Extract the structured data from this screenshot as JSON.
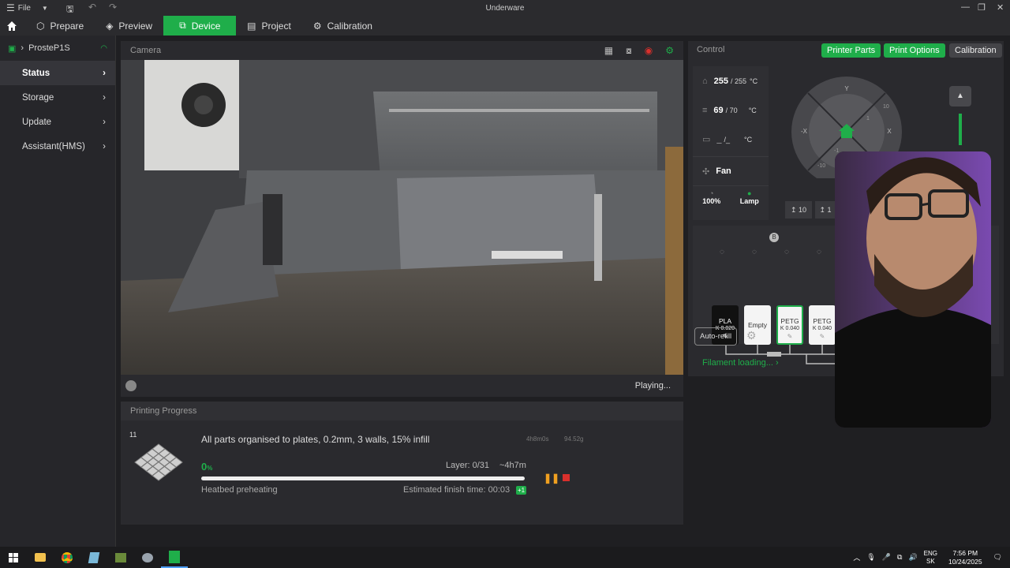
{
  "titlebar": {
    "file_label": "File",
    "app_title": "Underware"
  },
  "nav": {
    "tabs": [
      {
        "label": "Prepare"
      },
      {
        "label": "Preview"
      },
      {
        "label": "Device"
      },
      {
        "label": "Project"
      },
      {
        "label": "Calibration"
      }
    ]
  },
  "sidebar": {
    "device_name": "ProsteP1S",
    "items": [
      {
        "label": "Status"
      },
      {
        "label": "Storage"
      },
      {
        "label": "Update"
      },
      {
        "label": "Assistant(HMS)"
      }
    ]
  },
  "camera": {
    "title": "Camera",
    "status": "Playing..."
  },
  "progress": {
    "title": "Printing Progress",
    "plate_number": "11",
    "job_name": "All parts organised to plates, 0.2mm, 3 walls, 15% infill",
    "print_time": "4h8m0s",
    "weight": "94.52g",
    "percent_value": "0",
    "percent_unit": "%",
    "percent_fraction": 0.0,
    "layer": "Layer: 0/31",
    "remaining": "~4h7m",
    "stage": "Heatbed preheating",
    "finish_time": "Estimated finish time: 00:03",
    "day_badge": "+1"
  },
  "control": {
    "title": "Control",
    "buttons": {
      "printer_parts": "Printer Parts",
      "print_options": "Print Options",
      "calibration": "Calibration"
    },
    "nozzle": {
      "current": "255",
      "target": "/ 255",
      "unit": "°C"
    },
    "bed": {
      "current": "69",
      "target": "/ 70",
      "unit": "°C"
    },
    "chamber": {
      "current": "_",
      "target": "/_",
      "unit": "°C"
    },
    "fan_label": "Fan",
    "speed_value": "100%",
    "lamp_label": "Lamp",
    "jog": {
      "y": "Y",
      "neg_x": "-X",
      "x": "X",
      "y10": "10",
      "neg_y10": "-10",
      "y1": "1",
      "neg_y1": "-1"
    },
    "z_buttons": [
      "10",
      "1"
    ],
    "ams_unit": "B",
    "spools": [
      {
        "type": "PLA",
        "k": "K 0.020",
        "bg": "#111111",
        "fg": "#ffffff",
        "border": "#111111"
      },
      {
        "type": "Empty",
        "k": "",
        "bg": "#f4f4f4",
        "fg": "#333333",
        "border": "#f4f4f4"
      },
      {
        "type": "PETG",
        "k": "K 0.040",
        "bg": "#f4f4f4",
        "fg": "#333333",
        "border": "#1fae4a"
      },
      {
        "type": "PETG",
        "k": "K 0.040",
        "bg": "#f4f4f4",
        "fg": "#333333",
        "border": "#f4f4f4"
      }
    ],
    "auto_refill": "Auto-refill",
    "filament_loading": "Filament loading..."
  },
  "taskbar": {
    "lang_top": "ENG",
    "lang_bottom": "SK",
    "time": "7:56 PM",
    "date": "10/24/2025"
  },
  "colors": {
    "accent": "#1fae4a",
    "panel": "#2a2a2e",
    "pause": "#f0a020",
    "stop": "#d9302c"
  }
}
